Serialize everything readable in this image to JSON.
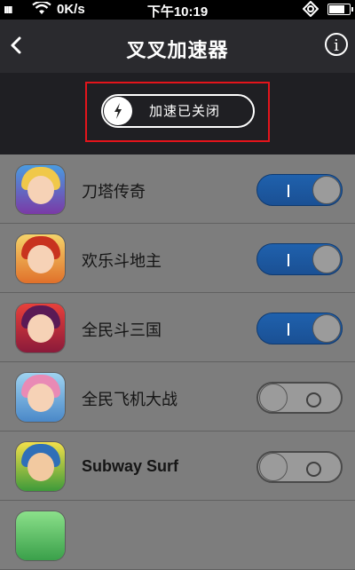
{
  "status_bar": {
    "signal": "ıııı",
    "network_speed": "0K/s",
    "time": "下午10:19",
    "battery_level": 0.85
  },
  "nav": {
    "title": "叉叉加速器",
    "info_label": "i"
  },
  "accelerator": {
    "label": "加速已关闭",
    "enabled": false
  },
  "games": [
    {
      "name": "刀塔传奇",
      "enabled": true,
      "icon": "dota-legend-app-icon"
    },
    {
      "name": "欢乐斗地主",
      "enabled": true,
      "icon": "happy-landlord-app-icon"
    },
    {
      "name": "全民斗三国",
      "enabled": true,
      "icon": "three-kingdoms-app-icon"
    },
    {
      "name": "全民飞机大战",
      "enabled": false,
      "icon": "plane-war-app-icon"
    },
    {
      "name": "Subway Surf",
      "enabled": false,
      "icon": "subway-surf-app-icon"
    }
  ],
  "colors": {
    "nav_background": "#2a2a2e",
    "list_background": "#7d7d7d",
    "toggle_on": "#1f61ad",
    "highlight_border": "#e3141b"
  }
}
